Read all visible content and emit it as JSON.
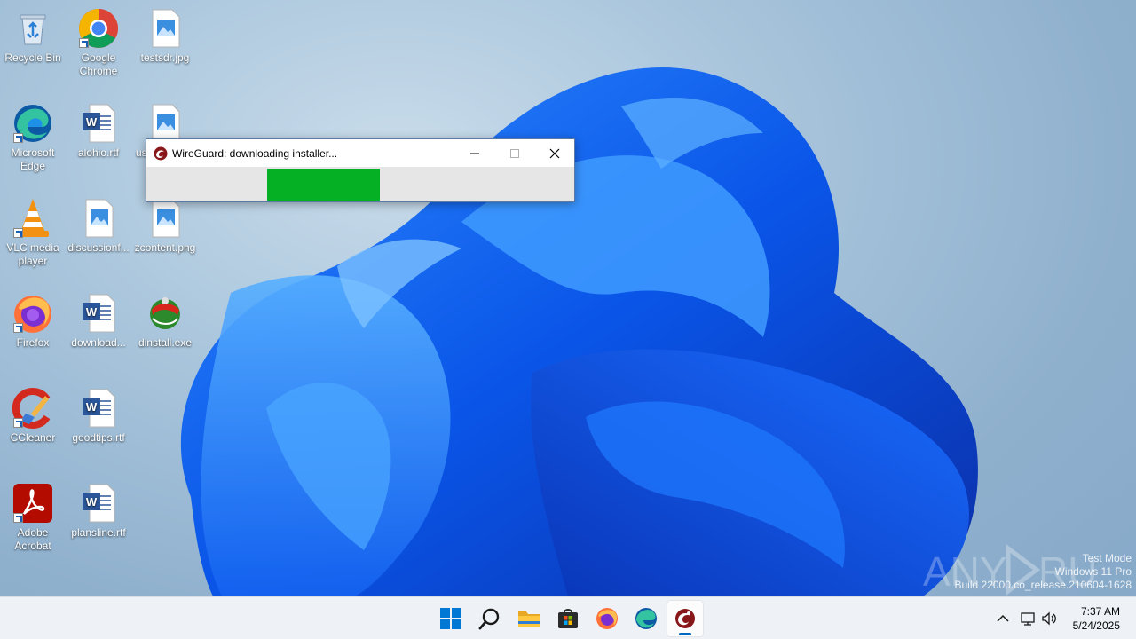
{
  "desktop": {
    "icons": [
      {
        "label": "Recycle Bin",
        "icon": "recycle-bin-icon"
      },
      {
        "label": "Google Chrome",
        "icon": "chrome-icon"
      },
      {
        "label": "testsdr.jpg",
        "icon": "image-file-icon"
      },
      {
        "label": "Microsoft Edge",
        "icon": "edge-icon"
      },
      {
        "label": "alohio.rtf",
        "icon": "word-document-icon"
      },
      {
        "label": "us",
        "icon": "image-file-icon"
      },
      {
        "label": "VLC media player",
        "icon": "vlc-icon"
      },
      {
        "label": "discussionf...",
        "icon": "image-file-icon"
      },
      {
        "label": "zcontent.png",
        "icon": "image-file-icon"
      },
      {
        "label": "Firefox",
        "icon": "firefox-icon"
      },
      {
        "label": "download...",
        "icon": "word-document-icon"
      },
      {
        "label": "dinstall.exe",
        "icon": "installer-exe-icon"
      },
      {
        "label": "CCleaner",
        "icon": "ccleaner-icon"
      },
      {
        "label": "goodtips.rtf",
        "icon": "word-document-icon"
      },
      {
        "label": "Adobe Acrobat",
        "icon": "acrobat-icon"
      },
      {
        "label": "plansline.rtf",
        "icon": "word-document-icon"
      }
    ]
  },
  "dialog": {
    "title": "WireGuard: downloading installer...",
    "icon": "wireguard-icon",
    "progress": {
      "start": 0.283,
      "end": 0.547,
      "color": "#06b025",
      "style": "marquee"
    }
  },
  "watermark": {
    "text": "ANY RUN"
  },
  "system_info": {
    "line1": "Test Mode",
    "line2": "Windows 11 Pro",
    "line3": "Build 22000.co_release.210604-1628"
  },
  "taskbar": {
    "apps": [
      "start-icon",
      "search-icon",
      "file-explorer-icon",
      "microsoft-store-icon",
      "firefox-icon",
      "edge-icon",
      "wireguard-icon"
    ],
    "active_app": "wireguard-icon",
    "tray": [
      "chevron-up-icon",
      "network-icon",
      "volume-icon"
    ],
    "time": "7:37 AM",
    "date": "5/24/2025"
  },
  "colors": {
    "accent": "#0067c0",
    "progress": "#06b025"
  }
}
